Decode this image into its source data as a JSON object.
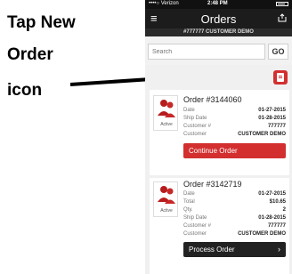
{
  "annotation": {
    "line1": "Tap New",
    "line2": "Order",
    "line3": "icon"
  },
  "status_bar": {
    "carrier": "••••○ Verizon",
    "time": "2:48 PM"
  },
  "navbar": {
    "menu_glyph": "≡",
    "title": "Orders",
    "subtitle": "#777777 CUSTOMER DEMO"
  },
  "search": {
    "placeholder": "Search",
    "go_label": "GO"
  },
  "orders": [
    {
      "title": "Order #3144060",
      "status": "Active",
      "rows": [
        {
          "k": "Date",
          "v": "01-27-2015"
        },
        {
          "k": "Ship Date",
          "v": "01-28-2015"
        },
        {
          "k": "Customer #",
          "v": "777777"
        },
        {
          "k": "Customer",
          "v": "CUSTOMER DEMO"
        }
      ],
      "action": "Continue Order"
    },
    {
      "title": "Order #3142719",
      "status": "Active",
      "rows": [
        {
          "k": "Date",
          "v": "01-27-2015"
        },
        {
          "k": "Total",
          "v": "$10.65"
        },
        {
          "k": "Qty.",
          "v": "2"
        },
        {
          "k": "Ship Date",
          "v": "01-28-2015"
        },
        {
          "k": "Customer #",
          "v": "777777"
        },
        {
          "k": "Customer",
          "v": "CUSTOMER DEMO"
        }
      ],
      "action": "Process Order",
      "action_chevron": "›"
    }
  ],
  "colors": {
    "accent_red": "#d32f2f",
    "nav_dark": "#1c1c1c"
  }
}
